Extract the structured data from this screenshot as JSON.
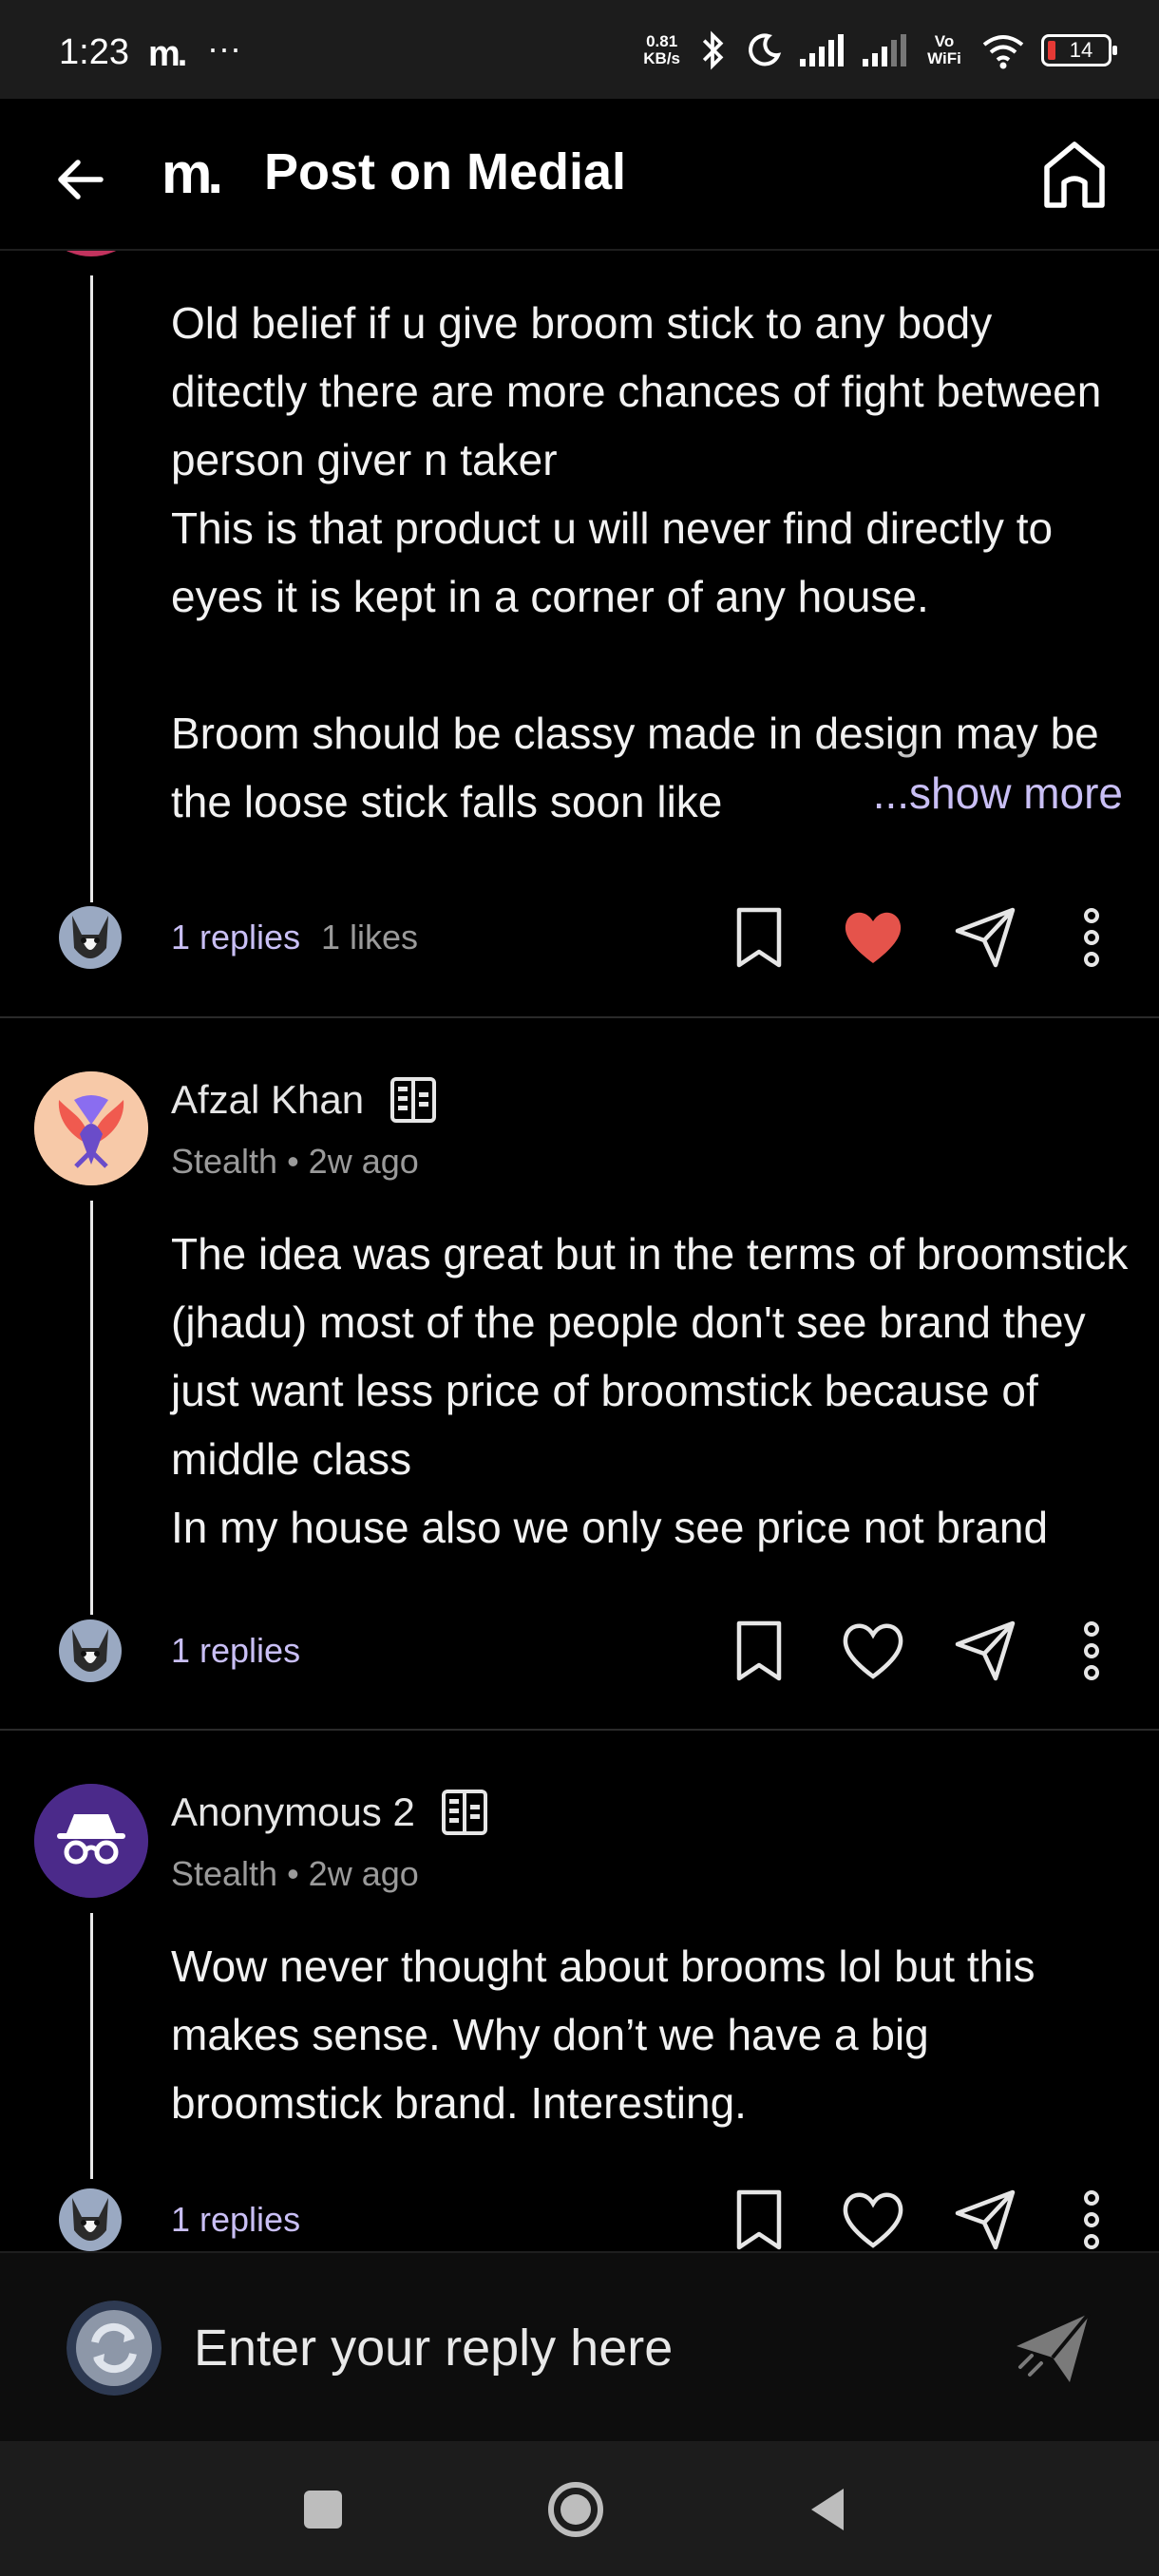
{
  "status_bar": {
    "time": "1:23",
    "app_logo": "m.",
    "more_dots": "···",
    "net_speed_value": "0.81",
    "net_speed_unit": "KB/s",
    "vowifi": "Vo WiFi",
    "battery": "14"
  },
  "header": {
    "logo": "m.",
    "title": "Post on Medial"
  },
  "comments": [
    {
      "body": "Old belief if u give broom stick to any body ditectly there are more chances of fight between person giver n taker\nThis is that product u will never find directly to eyes it is kept in a corner of any house.\n\nBroom should be classy made in design may be the loose stick falls soon like",
      "show_more": "...show more",
      "replies": "1 replies",
      "likes": "1 likes",
      "liked": true
    },
    {
      "author": "Afzal Khan",
      "meta": "Stealth • 2w ago",
      "body": "The idea was great but in the terms of broomstick (jhadu) most of the people don't see brand they just want less price of broomstick because of middle class\nIn my house also we only see price not brand",
      "replies": "1 replies",
      "liked": false
    },
    {
      "author": "Anonymous 2",
      "meta": "Stealth • 2w ago",
      "body": "Wow never thought about brooms lol but this makes sense. Why don’t we have a big broomstick brand. Interesting.",
      "replies": "1 replies",
      "liked": false
    }
  ],
  "reply_bar": {
    "placeholder": "Enter your reply here"
  },
  "colors": {
    "accent": "#c9bff5",
    "like_red": "#e5534b",
    "anon_purple": "#4b2a8a",
    "avatar_peach": "#f7c9a8"
  },
  "icons": [
    "back-arrow-icon",
    "home-icon",
    "bookmark-icon",
    "heart-icon",
    "share-icon",
    "more-icon",
    "send-icon",
    "company-icon"
  ]
}
